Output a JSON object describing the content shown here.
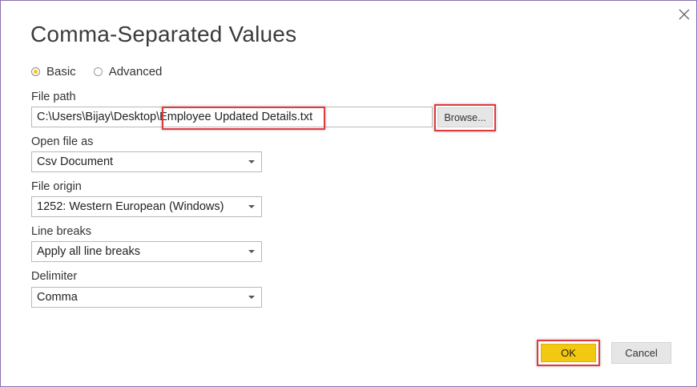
{
  "dialog": {
    "title": "Comma-Separated Values",
    "close_icon": "close-icon"
  },
  "mode": {
    "options": [
      {
        "label": "Basic",
        "selected": true
      },
      {
        "label": "Advanced",
        "selected": false
      }
    ]
  },
  "file_path": {
    "label": "File path",
    "value": "C:\\Users\\Bijay\\Desktop\\Employee Updated Details.txt",
    "browse_label": "Browse..."
  },
  "open_file_as": {
    "label": "Open file as",
    "value": "Csv Document"
  },
  "file_origin": {
    "label": "File origin",
    "value": "1252: Western European (Windows)"
  },
  "line_breaks": {
    "label": "Line breaks",
    "value": "Apply all line breaks"
  },
  "delimiter": {
    "label": "Delimiter",
    "value": "Comma"
  },
  "footer": {
    "ok_label": "OK",
    "cancel_label": "Cancel"
  },
  "colors": {
    "accent": "#f2c811",
    "highlight": "#e03a3e",
    "dialog_border": "#8a6fb0"
  }
}
